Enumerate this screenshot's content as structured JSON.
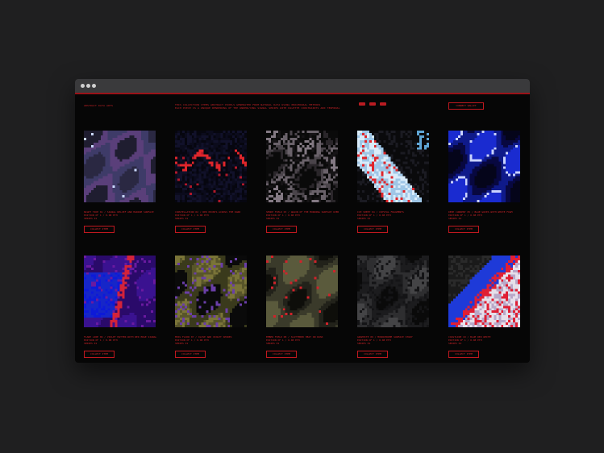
{
  "header": {
    "brand": "ABSTRACT DATA ARTS",
    "intro_line_1": "THIS COLLECTION ITEMS ABSTRACT PIXELS GENERATED FROM NATURAL DATA USING PROCEDURAL METHODS",
    "intro_line_2": "EACH PIECE IS A UNIQUE RENDERING OF THE UNDERLYING SIGNAL SERIES WITH PALETTE CONSTRAINTS AND TERMINAL",
    "connect_label": "CONNECT WALLET"
  },
  "colors": {
    "accent": "#d1262c",
    "window_bg": "#060606",
    "desktop_bg": "#1f1f20",
    "titlebar": "#3a3a3c"
  },
  "cards": [
    {
      "title": "NIGHT TIDE 01 / SIGNAL RELIEF AND MARINE SURFACE",
      "meta_1": "EDITION OF 1 / 0.08 ETH",
      "meta_2": "SERIES 01",
      "button": "COLLECT ITEM",
      "palette": [
        "#191622",
        "#2a2842",
        "#3e3b68",
        "#5a3f7a",
        "#1f1d30",
        "#c9d7ff"
      ],
      "style": "noise"
    },
    {
      "title": "CONSTELLATION 02 / RED POINTS ACROSS THE DARK",
      "meta_1": "EDITION OF 1 / 0.08 ETH",
      "meta_2": "SERIES 01",
      "button": "COLLECT ITEM",
      "palette": [
        "#06060f",
        "#0b0b1c",
        "#11112a",
        "#e0262b",
        "#b0182a"
      ],
      "style": "dots"
    },
    {
      "title": "SMOKE FIELD 03 / GRAIN OF THE MORNING SURFACE OVERLAY",
      "meta_1": "EDITION OF 1 / 0.08 ETH",
      "meta_2": "SERIES 01",
      "button": "COLLECT ITEM",
      "palette": [
        "#0a0a0a",
        "#2a262a",
        "#4a444a",
        "#6a626a",
        "#161416",
        "#837983"
      ],
      "style": "smoke"
    },
    {
      "title": "ICE SHEET 04 / CRYSTAL FRAGMENTS",
      "meta_1": "EDITION OF 1 / 0.08 ETH",
      "meta_2": "SERIES 01",
      "button": "COLLECT ITEM",
      "palette": [
        "#0a0a0c",
        "#9fc6e6",
        "#d9ecfa",
        "#e0262b",
        "#1b1b22",
        "#5fa6d6"
      ],
      "style": "ice"
    },
    {
      "title": "DEEP CURRENT 05 / BLUE WAVES WITH WHITE FOAM",
      "meta_1": "EDITION OF 1 / 0.08 ETH",
      "meta_2": "SERIES 01",
      "button": "COLLECT ITEM",
      "palette": [
        "#05051a",
        "#0f1a8a",
        "#1a2bd0",
        "#c9d2ff",
        "#080840"
      ],
      "style": "waves"
    },
    {
      "title": "FLARE LINE 06 / VIOLET MATTER WITH RED EDGE SIGNAL",
      "meta_1": "EDITION OF 1 / 0.08 ETH",
      "meta_2": "SERIES 01",
      "button": "COLLECT ITEM",
      "palette": [
        "#2a0a6a",
        "#3a1290",
        "#1626c8",
        "#0d1ad8",
        "#d3233a",
        "#6a1aa0"
      ],
      "style": "flare"
    },
    {
      "title": "MOSS FLOOR 07 / OLIVE AND VIOLET SPORES",
      "meta_1": "EDITION OF 1 / 0.08 ETH",
      "meta_2": "SERIES 01",
      "button": "COLLECT ITEM",
      "palette": [
        "#0a0a0a",
        "#58552a",
        "#7a7438",
        "#6a3ea8",
        "#3a3a1c",
        "#2a2a2a"
      ],
      "style": "moss"
    },
    {
      "title": "EMBER FIELD 08 / SCATTERED HEAT ON DUSK",
      "meta_1": "EDITION OF 1 / 0.08 ETH",
      "meta_2": "SERIES 01",
      "button": "COLLECT ITEM",
      "palette": [
        "#0e0e0a",
        "#3a3a2a",
        "#5a5a3c",
        "#d0232b",
        "#22221a"
      ],
      "style": "ember"
    },
    {
      "title": "GRAPHITE 09 / MONOCHROME SURFACE STUDY",
      "meta_1": "EDITION OF 1 / 0.08 ETH",
      "meta_2": "SERIES 01",
      "button": "COLLECT ITEM",
      "palette": [
        "#0a0a0a",
        "#1c1c1e",
        "#2e2e30",
        "#444446",
        "#141416"
      ],
      "style": "graphite"
    },
    {
      "title": "COASTLINE 10 / BLUE RED WHITE",
      "meta_1": "EDITION OF 1 / 0.08 ETH",
      "meta_2": "SERIES 01",
      "button": "COLLECT ITEM",
      "palette": [
        "#1a1a1a",
        "#1e3ad8",
        "#e01f34",
        "#e6e0ea",
        "#b8a8c8",
        "#2a2a2a"
      ],
      "style": "coast"
    }
  ]
}
